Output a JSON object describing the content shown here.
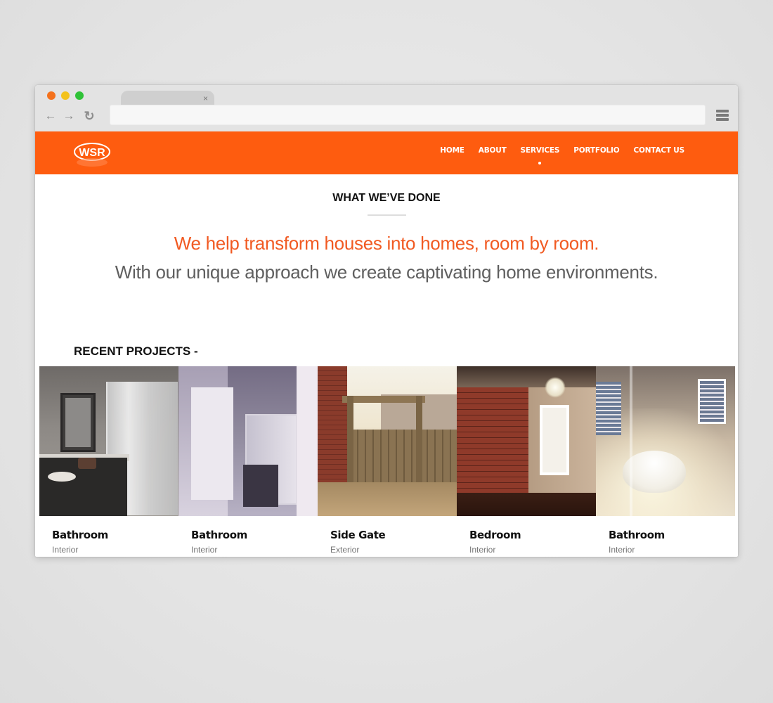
{
  "browser": {
    "tab_close": "×",
    "icons": {
      "back": "arrow-left-icon",
      "forward": "arrow-right-icon",
      "reload": "reload-icon",
      "menu": "hamburger-menu-icon"
    },
    "glyphs": {
      "back": "←",
      "forward": "→",
      "reload": "↻"
    },
    "traffic_lights": [
      "#f4711c",
      "#f3c21c",
      "#2fc237"
    ]
  },
  "site": {
    "logo_text": "WSR",
    "accent_color": "#fe5c0f",
    "nav": [
      {
        "label": "HOME",
        "active": false
      },
      {
        "label": "ABOUT",
        "active": false
      },
      {
        "label": "SERVICES",
        "active": true
      },
      {
        "label": "PORTFOLIO",
        "active": false
      },
      {
        "label": "CONTACT US",
        "active": false
      }
    ]
  },
  "main": {
    "section_title": "WHAT WE’VE DONE",
    "tagline_1": "We help transform houses into homes, room by room.",
    "tagline_2": "With our unique approach we create captivating home environments.",
    "recent_title": "RECENT PROJECTS -",
    "projects": [
      {
        "name": "Bathroom",
        "category": "Interior"
      },
      {
        "name": "Bathroom",
        "category": "Interior"
      },
      {
        "name": "Side Gate",
        "category": "Exterior"
      },
      {
        "name": "Bedroom",
        "category": "Interior"
      },
      {
        "name": "Bathroom",
        "category": "Interior"
      }
    ]
  }
}
